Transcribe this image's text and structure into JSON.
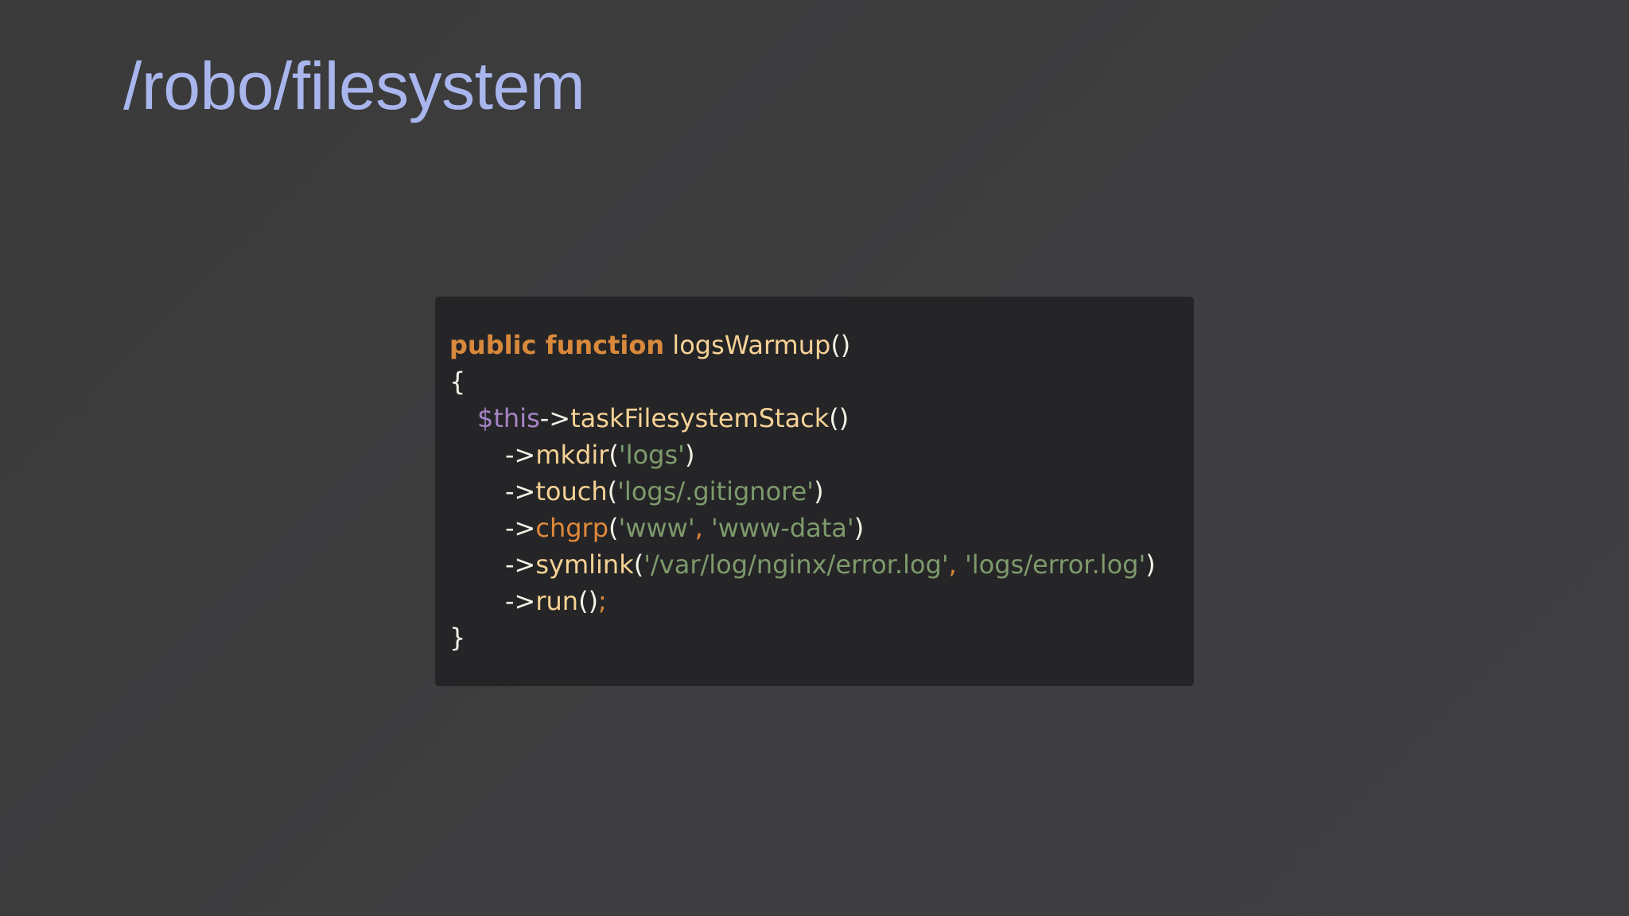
{
  "slide": {
    "title": "/robo/filesystem"
  },
  "code": {
    "line1": {
      "keyword": "public function",
      "space": " ",
      "function_name": "logsWarmup",
      "parens": "()"
    },
    "line2": {
      "brace": "{"
    },
    "line3": {
      "variable": "$this",
      "arrow": "->",
      "method": "taskFilesystemStack",
      "parens": "()"
    },
    "line4": {
      "arrow": "->",
      "method": "mkdir",
      "open": "(",
      "arg1": "'logs'",
      "close": ")"
    },
    "line5": {
      "arrow": "->",
      "method": "touch",
      "open": "(",
      "arg1": "'logs/.gitignore'",
      "close": ")"
    },
    "line6": {
      "arrow": "->",
      "method": "chgrp",
      "open": "(",
      "arg1": "'www'",
      "comma": ", ",
      "arg2": "'www-data'",
      "close": ")"
    },
    "line7": {
      "arrow": "->",
      "method": "symlink",
      "open": "(",
      "arg1": "'/var/log/nginx/error.log'",
      "comma": ", ",
      "arg2": "'logs/error.log'",
      "close": ")"
    },
    "line8": {
      "arrow": "->",
      "method": "run",
      "parens": "()",
      "semicolon": ";"
    },
    "line9": {
      "brace": "}"
    }
  },
  "colors": {
    "background": "#3d3d3f",
    "title": "#a9b6ee",
    "code_background": "#252527",
    "keyword": "#d9893b",
    "function": "#f7d296",
    "variable": "#a784c7",
    "string": "#7e9a6c",
    "plain": "#f4f1e6"
  }
}
